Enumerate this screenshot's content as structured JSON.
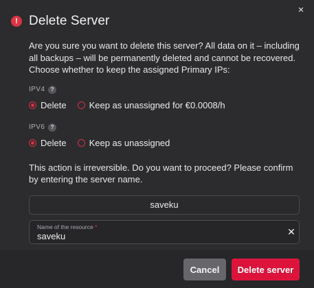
{
  "dialog": {
    "title": "Delete Server",
    "close_glyph": "×",
    "alert_glyph": "!",
    "description": "Are you sure you want to delete this server? All data on it – including all backups – will be permanently deleted and cannot be recovered. Choose whether to keep the assigned Primary IPs:",
    "ipv4": {
      "label": "IPV4",
      "help_glyph": "?",
      "options": [
        {
          "label": "Delete",
          "selected": true
        },
        {
          "label": "Keep as unassigned for €0.0008/h",
          "selected": false
        }
      ]
    },
    "ipv6": {
      "label": "IPV6",
      "help_glyph": "?",
      "options": [
        {
          "label": "Delete",
          "selected": true
        },
        {
          "label": "Keep as unassigned",
          "selected": false
        }
      ]
    },
    "confirm_text": "This action is irreversible. Do you want to proceed? Please confirm by entering the server name.",
    "server_name": "saveku",
    "input": {
      "label": "Name of the resource",
      "required_mark": "*",
      "value": "saveku",
      "clear_glyph": "✕"
    },
    "buttons": {
      "cancel": "Cancel",
      "delete": "Delete server"
    },
    "colors": {
      "accent": "#dc143c",
      "background": "#2c2c2e",
      "footer": "#27272a"
    }
  }
}
